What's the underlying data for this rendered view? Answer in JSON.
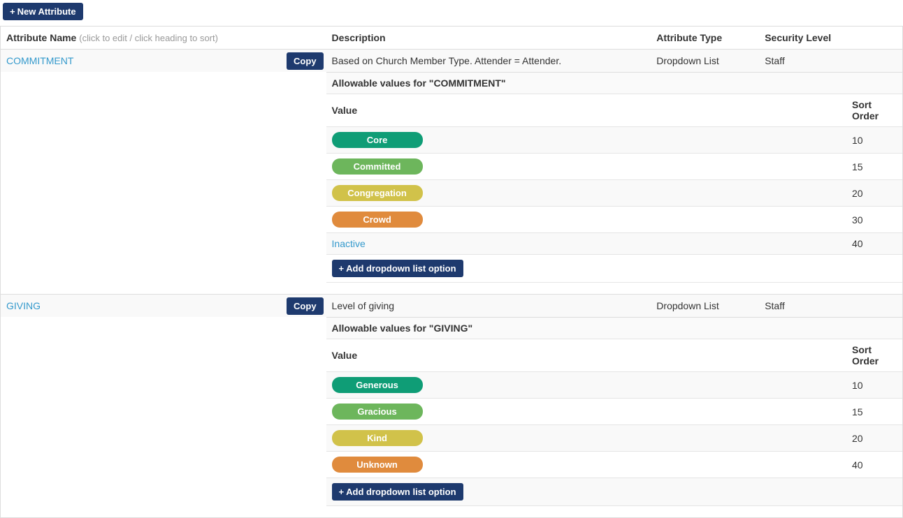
{
  "topbar": {
    "new_attribute": "New Attribute"
  },
  "headers": {
    "name": "Attribute Name",
    "name_hint": "(click to edit / click heading to sort)",
    "description": "Description",
    "type": "Attribute Type",
    "security": "Security Level"
  },
  "inner_headers": {
    "value": "Value",
    "sort_order": "Sort Order"
  },
  "buttons": {
    "copy": "Copy",
    "add_option": "Add dropdown list option"
  },
  "section_prefix": "Allowable values for",
  "attributes": [
    {
      "name": "COMMITMENT",
      "description": "Based on Church Member Type. Attender = Attender.",
      "type": "Dropdown List",
      "security": "Staff",
      "values": [
        {
          "label": "Core",
          "sort": "10",
          "kind": "pill",
          "color": "teal"
        },
        {
          "label": "Committed",
          "sort": "15",
          "kind": "pill",
          "color": "green"
        },
        {
          "label": "Congregation",
          "sort": "20",
          "kind": "pill",
          "color": "yellow"
        },
        {
          "label": "Crowd",
          "sort": "30",
          "kind": "pill",
          "color": "orange"
        },
        {
          "label": "Inactive",
          "sort": "40",
          "kind": "link"
        }
      ]
    },
    {
      "name": "GIVING",
      "description": "Level of giving",
      "type": "Dropdown List",
      "security": "Staff",
      "values": [
        {
          "label": "Generous",
          "sort": "10",
          "kind": "pill",
          "color": "teal"
        },
        {
          "label": "Gracious",
          "sort": "15",
          "kind": "pill",
          "color": "green"
        },
        {
          "label": "Kind",
          "sort": "20",
          "kind": "pill",
          "color": "yellow"
        },
        {
          "label": "Unknown",
          "sort": "40",
          "kind": "pill",
          "color": "orange"
        }
      ]
    }
  ]
}
